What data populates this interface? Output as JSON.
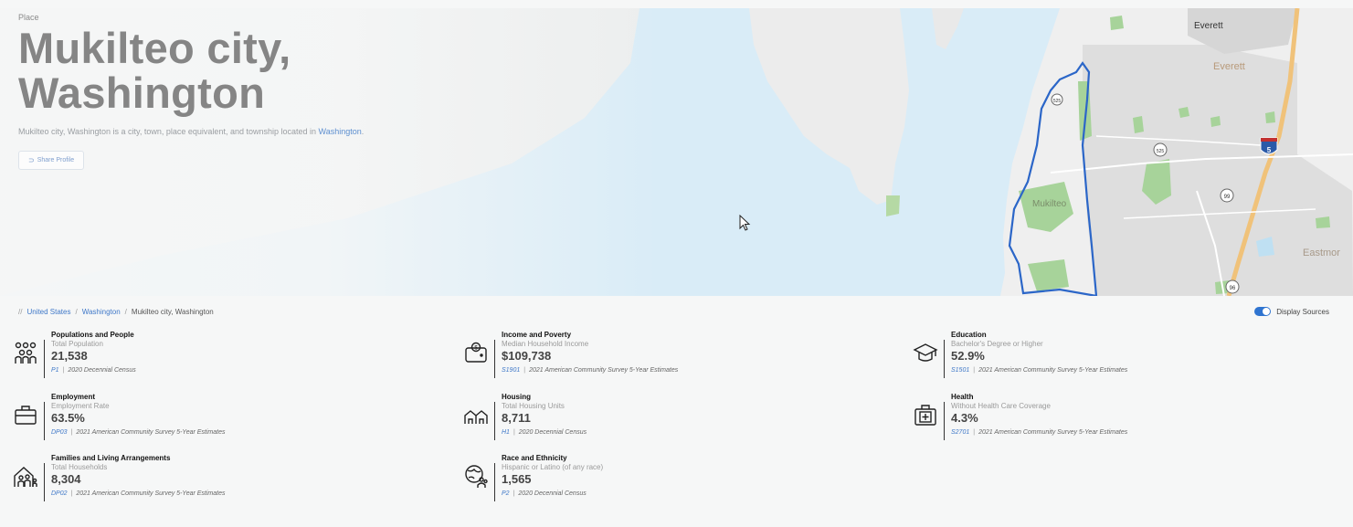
{
  "hero": {
    "place_label": "Place",
    "title_line1": "Mukilteo city,",
    "title_line2": "Washington",
    "description_prefix": "Mukilteo city, Washington is a city, town, place equivalent, and township located in",
    "description_link": "Washington",
    "description_suffix": ".",
    "share_button": "Share Profile",
    "share_icon": "link-icon"
  },
  "map": {
    "labels": {
      "everett_top": "Everett",
      "everett_city": "Everett",
      "mukilteo": "Mukilteo",
      "eastmont": "Eastmor"
    },
    "shields": {
      "route_525_a": "525",
      "route_525_b": "525",
      "route_99": "99",
      "route_96": "96",
      "interstate_5": "5"
    },
    "colors": {
      "water": "#d9ecf7",
      "land": "#efefef",
      "city_area": "#d8d8d8",
      "park": "#a7d39a",
      "highway": "#f0c27a",
      "boundary": "#2b66c8"
    }
  },
  "breadcrumb": {
    "prefix": "//",
    "items": [
      "United States",
      "Washington",
      "Mukilteo city, Washington"
    ],
    "separator": "/"
  },
  "display_sources": {
    "label": "Display Sources",
    "enabled": true
  },
  "stats": [
    {
      "category": "Populations and People",
      "metric": "Total Population",
      "value": "21,538",
      "source_code": "P1",
      "source": "2020 Decennial Census",
      "icon": "people-group-icon"
    },
    {
      "category": "Income and Poverty",
      "metric": "Median Household Income",
      "value": "$109,738",
      "source_code": "S1901",
      "source": "2021 American Community Survey 5-Year Estimates",
      "icon": "wallet-icon"
    },
    {
      "category": "Education",
      "metric": "Bachelor's Degree or Higher",
      "value": "52.9%",
      "source_code": "S1501",
      "source": "2021 American Community Survey 5-Year Estimates",
      "icon": "graduation-cap-icon"
    },
    {
      "category": "Employment",
      "metric": "Employment Rate",
      "value": "63.5%",
      "source_code": "DP03",
      "source": "2021 American Community Survey 5-Year Estimates",
      "icon": "briefcase-icon"
    },
    {
      "category": "Housing",
      "metric": "Total Housing Units",
      "value": "8,711",
      "source_code": "H1",
      "source": "2020 Decennial Census",
      "icon": "houses-icon"
    },
    {
      "category": "Health",
      "metric": "Without Health Care Coverage",
      "value": "4.3%",
      "source_code": "S2701",
      "source": "2021 American Community Survey 5-Year Estimates",
      "icon": "medical-kit-icon"
    },
    {
      "category": "Families and Living Arrangements",
      "metric": "Total Households",
      "value": "8,304",
      "source_code": "DP02",
      "source": "2021 American Community Survey 5-Year Estimates",
      "icon": "family-home-icon"
    },
    {
      "category": "Race and Ethnicity",
      "metric": "Hispanic or Latino (of any race)",
      "value": "1,565",
      "source_code": "P2",
      "source": "2020 Decennial Census",
      "icon": "globe-people-icon"
    }
  ]
}
